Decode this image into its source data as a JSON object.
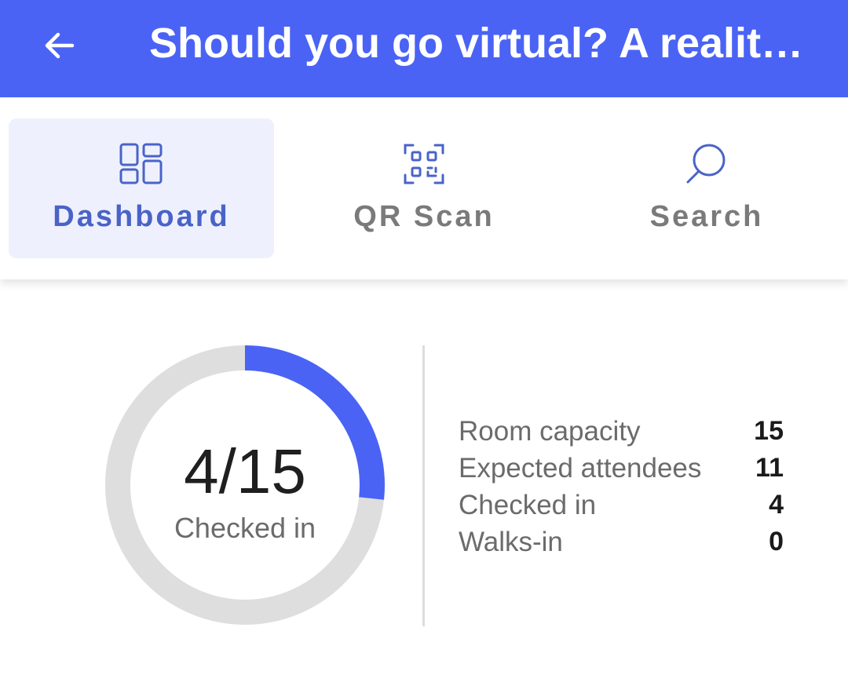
{
  "colors": {
    "appbar": "#4a63f5",
    "accent": "#4a63f5",
    "ring_track": "#dedede",
    "active_tab_bg": "#eef1fd"
  },
  "appbar": {
    "back_icon": "arrow-left-icon",
    "title": "Should you go virtual? A reality check"
  },
  "tabs": [
    {
      "label": "Dashboard",
      "icon": "dashboard-icon",
      "active": true
    },
    {
      "label": "QR Scan",
      "icon": "qr-scan-icon",
      "active": false
    },
    {
      "label": "Search",
      "icon": "search-icon",
      "active": false
    }
  ],
  "summary": {
    "checked_in": 4,
    "capacity": 15,
    "ratio_text": "4/15",
    "caption": "Checked in"
  },
  "stats": [
    {
      "label": "Room capacity",
      "value": "15"
    },
    {
      "label": "Expected attendees",
      "value": "11"
    },
    {
      "label": "Checked in",
      "value": "4"
    },
    {
      "label": "Walks-in",
      "value": "0"
    }
  ]
}
